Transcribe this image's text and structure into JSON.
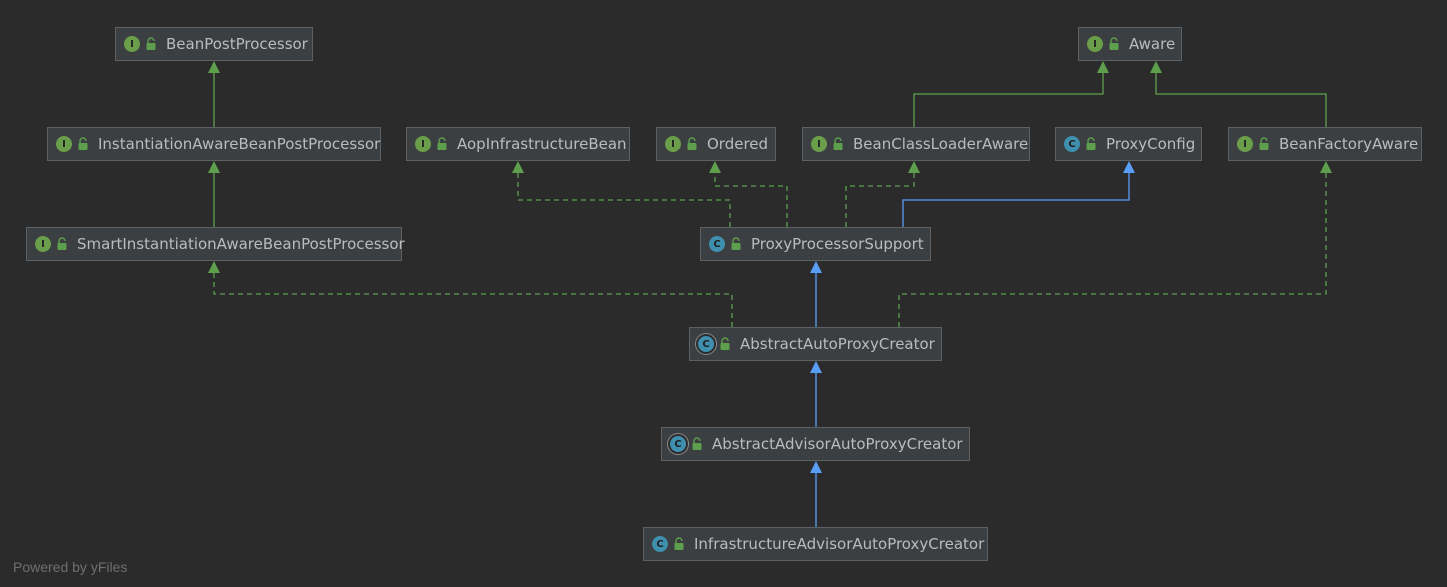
{
  "colors": {
    "background": "#2b2b2b",
    "node_fill": "#3c3f41",
    "node_border": "#5e6163",
    "text": "#bbbbbb",
    "interface_icon": "#6a9e4a",
    "class_icon": "#3f8fae",
    "extends_arrow": "#589df6",
    "implements_arrow": "#5e9f4e"
  },
  "nodes": [
    {
      "id": "bean-post-processor",
      "label": "BeanPostProcessor",
      "kind": "I",
      "kind_type": "interface",
      "icon": "interface-icon"
    },
    {
      "id": "aware",
      "label": "Aware",
      "kind": "I",
      "kind_type": "interface",
      "icon": "interface-icon"
    },
    {
      "id": "instantiation-aware-bean-post-processor",
      "label": "InstantiationAwareBeanPostProcessor",
      "kind": "I",
      "kind_type": "interface",
      "icon": "interface-icon"
    },
    {
      "id": "aop-infrastructure-bean",
      "label": "AopInfrastructureBean",
      "kind": "I",
      "kind_type": "interface",
      "icon": "interface-icon"
    },
    {
      "id": "ordered",
      "label": "Ordered",
      "kind": "I",
      "kind_type": "interface",
      "icon": "interface-icon"
    },
    {
      "id": "bean-class-loader-aware",
      "label": "BeanClassLoaderAware",
      "kind": "I",
      "kind_type": "interface",
      "icon": "interface-icon"
    },
    {
      "id": "proxy-config",
      "label": "ProxyConfig",
      "kind": "C",
      "kind_type": "class",
      "icon": "class-icon"
    },
    {
      "id": "bean-factory-aware",
      "label": "BeanFactoryAware",
      "kind": "I",
      "kind_type": "interface",
      "icon": "interface-icon"
    },
    {
      "id": "smart-instantiation-aware-bean-post-processor",
      "label": "SmartInstantiationAwareBeanPostProcessor",
      "kind": "I",
      "kind_type": "interface",
      "icon": "interface-icon"
    },
    {
      "id": "proxy-processor-support",
      "label": "ProxyProcessorSupport",
      "kind": "C",
      "kind_type": "class",
      "icon": "class-icon"
    },
    {
      "id": "abstract-auto-proxy-creator",
      "label": "AbstractAutoProxyCreator",
      "kind": "C",
      "kind_type": "abstract-class",
      "icon": "abstract-class-icon"
    },
    {
      "id": "abstract-advisor-auto-proxy-creator",
      "label": "AbstractAdvisorAutoProxyCreator",
      "kind": "C",
      "kind_type": "abstract-class",
      "icon": "abstract-class-icon"
    },
    {
      "id": "infrastructure-advisor-auto-proxy-creator",
      "label": "InfrastructureAdvisorAutoProxyCreator",
      "kind": "C",
      "kind_type": "class",
      "icon": "class-icon"
    }
  ],
  "edges": [
    {
      "from": "instantiation-aware-bean-post-processor",
      "to": "bean-post-processor",
      "type": "extends-interface"
    },
    {
      "from": "smart-instantiation-aware-bean-post-processor",
      "to": "instantiation-aware-bean-post-processor",
      "type": "extends-interface"
    },
    {
      "from": "bean-class-loader-aware",
      "to": "aware",
      "type": "extends-interface"
    },
    {
      "from": "bean-factory-aware",
      "to": "aware",
      "type": "extends-interface"
    },
    {
      "from": "proxy-processor-support",
      "to": "aop-infrastructure-bean",
      "type": "implements"
    },
    {
      "from": "proxy-processor-support",
      "to": "ordered",
      "type": "implements"
    },
    {
      "from": "proxy-processor-support",
      "to": "bean-class-loader-aware",
      "type": "implements"
    },
    {
      "from": "proxy-processor-support",
      "to": "proxy-config",
      "type": "extends"
    },
    {
      "from": "abstract-auto-proxy-creator",
      "to": "proxy-processor-support",
      "type": "extends"
    },
    {
      "from": "abstract-auto-proxy-creator",
      "to": "smart-instantiation-aware-bean-post-processor",
      "type": "implements"
    },
    {
      "from": "abstract-auto-proxy-creator",
      "to": "bean-factory-aware",
      "type": "implements"
    },
    {
      "from": "abstract-advisor-auto-proxy-creator",
      "to": "abstract-auto-proxy-creator",
      "type": "extends"
    },
    {
      "from": "infrastructure-advisor-auto-proxy-creator",
      "to": "abstract-advisor-auto-proxy-creator",
      "type": "extends"
    }
  ],
  "footer": {
    "credit": "Powered by yFiles"
  }
}
